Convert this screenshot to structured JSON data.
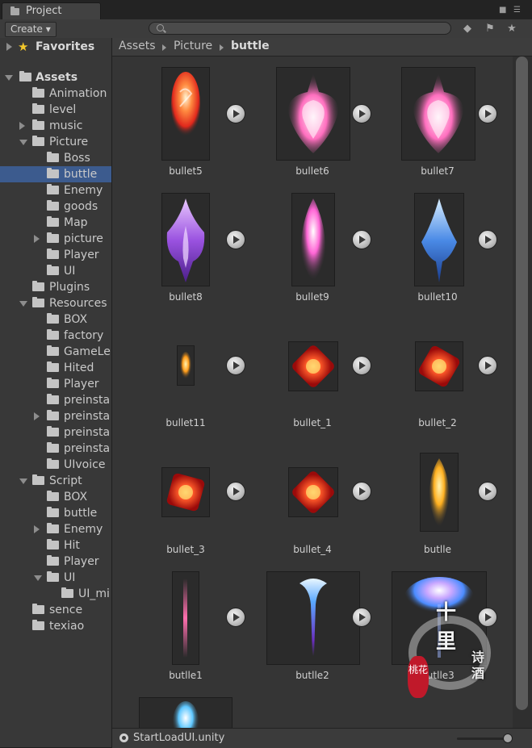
{
  "window": {
    "tab_label": "Project"
  },
  "toolbar": {
    "create_label": "Create",
    "search_placeholder": ""
  },
  "tree": {
    "favorites": "Favorites",
    "assets": "Assets",
    "items": [
      "Animation",
      "level",
      "music",
      "Picture",
      "Boss",
      "buttle",
      "Enemy",
      "goods",
      "Map",
      "picture",
      "Player",
      "UI",
      "Plugins",
      "Resources",
      "BOX",
      "factory",
      "GameLe",
      "Hited",
      "Player",
      "preinsta",
      "preinsta",
      "preinsta",
      "preinsta",
      "UIvoice",
      "Script",
      "BOX",
      "buttle",
      "Enemy",
      "Hit",
      "Player",
      "UI",
      "UI_mi",
      "sence",
      "texiao"
    ],
    "selected": "buttle"
  },
  "breadcrumb": {
    "c1": "Assets",
    "c2": "Picture",
    "c3": "buttle"
  },
  "assets": [
    "bullet5",
    "bullet6",
    "bullet7",
    "bullet8",
    "bullet9",
    "bullet10",
    "bullet11",
    "bullet_1",
    "bullet_2",
    "bullet_3",
    "bullet_4",
    "butlle",
    "butlle1",
    "butlle2",
    "butlle3"
  ],
  "status": {
    "file": "StartLoadUI.unity"
  },
  "watermark": {
    "top": "十",
    "mid": "里",
    "r1": "诗",
    "r2": "酒",
    "seal": "桃花"
  }
}
